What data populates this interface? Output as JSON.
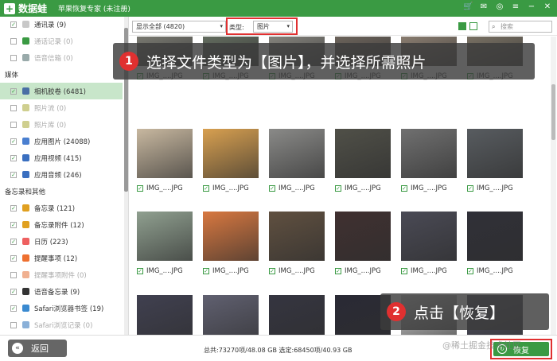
{
  "app": {
    "logo": "数据蛙",
    "title": "苹果恢复专家 (未注册)",
    "icons": [
      "cart-icon",
      "mail-icon",
      "chat-icon",
      "menu-icon",
      "minimize-icon",
      "close-icon"
    ]
  },
  "sidebar": {
    "sections": [
      {
        "label": "媒体"
      },
      {
        "label": "备忘录和其他"
      }
    ],
    "items": [
      {
        "label": "通讯录 (9)",
        "checked": true,
        "dim": false,
        "color": "#c8c8c8"
      },
      {
        "label": "通话记录 (0)",
        "checked": false,
        "dim": true,
        "color": "#3a9a43"
      },
      {
        "label": "语音信箱 (0)",
        "checked": false,
        "dim": true,
        "color": "#9aa"
      },
      {
        "label": "相机胶卷 (6481)",
        "checked": true,
        "dim": false,
        "color": "#4a6fa5",
        "selected": true
      },
      {
        "label": "照片流 (0)",
        "checked": false,
        "dim": true,
        "color": "#cfcf8f"
      },
      {
        "label": "照片库 (0)",
        "checked": false,
        "dim": true,
        "color": "#cfcf8f"
      },
      {
        "label": "应用图片 (24088)",
        "checked": true,
        "dim": false,
        "color": "#4a7fd0"
      },
      {
        "label": "应用视频 (415)",
        "checked": true,
        "dim": false,
        "color": "#3a6fc0"
      },
      {
        "label": "应用音频 (246)",
        "checked": true,
        "dim": false,
        "color": "#3a6fc0"
      },
      {
        "label": "备忘录 (121)",
        "checked": true,
        "dim": false,
        "color": "#e0a020"
      },
      {
        "label": "备忘录附件 (12)",
        "checked": true,
        "dim": false,
        "color": "#e0a020"
      },
      {
        "label": "日历 (223)",
        "checked": true,
        "dim": false,
        "color": "#ee6060"
      },
      {
        "label": "提醒事项 (12)",
        "checked": true,
        "dim": false,
        "color": "#ee7030"
      },
      {
        "label": "提醒事项附件 (0)",
        "checked": false,
        "dim": true,
        "color": "#f0b090"
      },
      {
        "label": "语音备忘录 (9)",
        "checked": true,
        "dim": false,
        "color": "#333"
      },
      {
        "label": "Safari浏览器书签 (19)",
        "checked": true,
        "dim": false,
        "color": "#3a8ad0"
      },
      {
        "label": "Safari浏览记录 (0)",
        "checked": false,
        "dim": true,
        "color": "#8ab0d8"
      }
    ]
  },
  "toolbar": {
    "filter_value": "显示全部 (4820)",
    "type_label": "类型:",
    "type_value": "图片",
    "search_placeholder": "搜索"
  },
  "grid": {
    "filename": "IMG_....JPG",
    "rows": [
      [
        "#8a8a80",
        "#6f7a6a",
        "#9a9890",
        "#7a7066",
        "#a09080",
        "#8a8070"
      ],
      [
        "#c8b8a0",
        "#d8a050",
        "#8a8a88",
        "#505048",
        "#707070",
        "#585c60"
      ],
      [
        "#90a090",
        "#d87840",
        "#605040",
        "#403030",
        "#4a4a55",
        "#303038"
      ],
      [
        "#404050",
        "#606070",
        "#353540",
        "#2a2a35",
        "#d0d0d0",
        "#505060"
      ]
    ],
    "cell_checked": [
      [
        true,
        true,
        true,
        true,
        true,
        true
      ],
      [
        true,
        true,
        true,
        true,
        true,
        true
      ],
      [
        true,
        true,
        true,
        true,
        true,
        true
      ],
      [
        true,
        true,
        true,
        true,
        true,
        true
      ]
    ]
  },
  "callouts": [
    {
      "num": "1",
      "text": "选择文件类型为【图片】，并选择所需照片"
    },
    {
      "num": "2",
      "text": "点击【恢复】"
    }
  ],
  "bottom": {
    "back_label": "返回",
    "status": "总共:73270项/48.08 GB 选定:68450项/40.93 GB",
    "recover_label": "恢复",
    "watermark": "@稀土掘金技术社区"
  },
  "colors": {
    "brand": "#3a9a43",
    "highlight": "#e03030"
  }
}
